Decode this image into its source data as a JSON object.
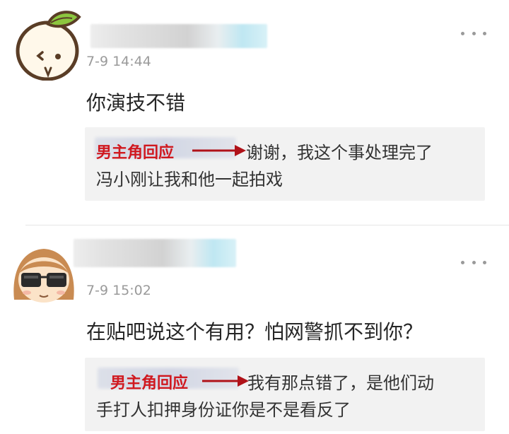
{
  "comments": [
    {
      "time": "7-9 14:44",
      "text": "你演技不错",
      "reply_tag": "男主角回应",
      "reply_line1": "谢谢，我这个事处理完了",
      "reply_line2": "冯小刚让我和他一起拍戏",
      "avatar": "orange-cartoon-avatar"
    },
    {
      "time": "7-9 15:02",
      "text": "在贴吧说这个有用？怕网警抓不到你？",
      "reply_tag": "男主角回应",
      "reply_line1": "我有那点错了，是他们动",
      "reply_line2": "手打人扣押身份证你是不是看反了",
      "avatar": "sunglasses-girl-avatar"
    }
  ],
  "colors": {
    "tag_red": "#d0181f",
    "reply_bg": "#f2f2f2",
    "timestamp_gray": "#9a9a9a"
  },
  "icons": [
    "more-options-icon",
    "red-arrow-icon"
  ]
}
